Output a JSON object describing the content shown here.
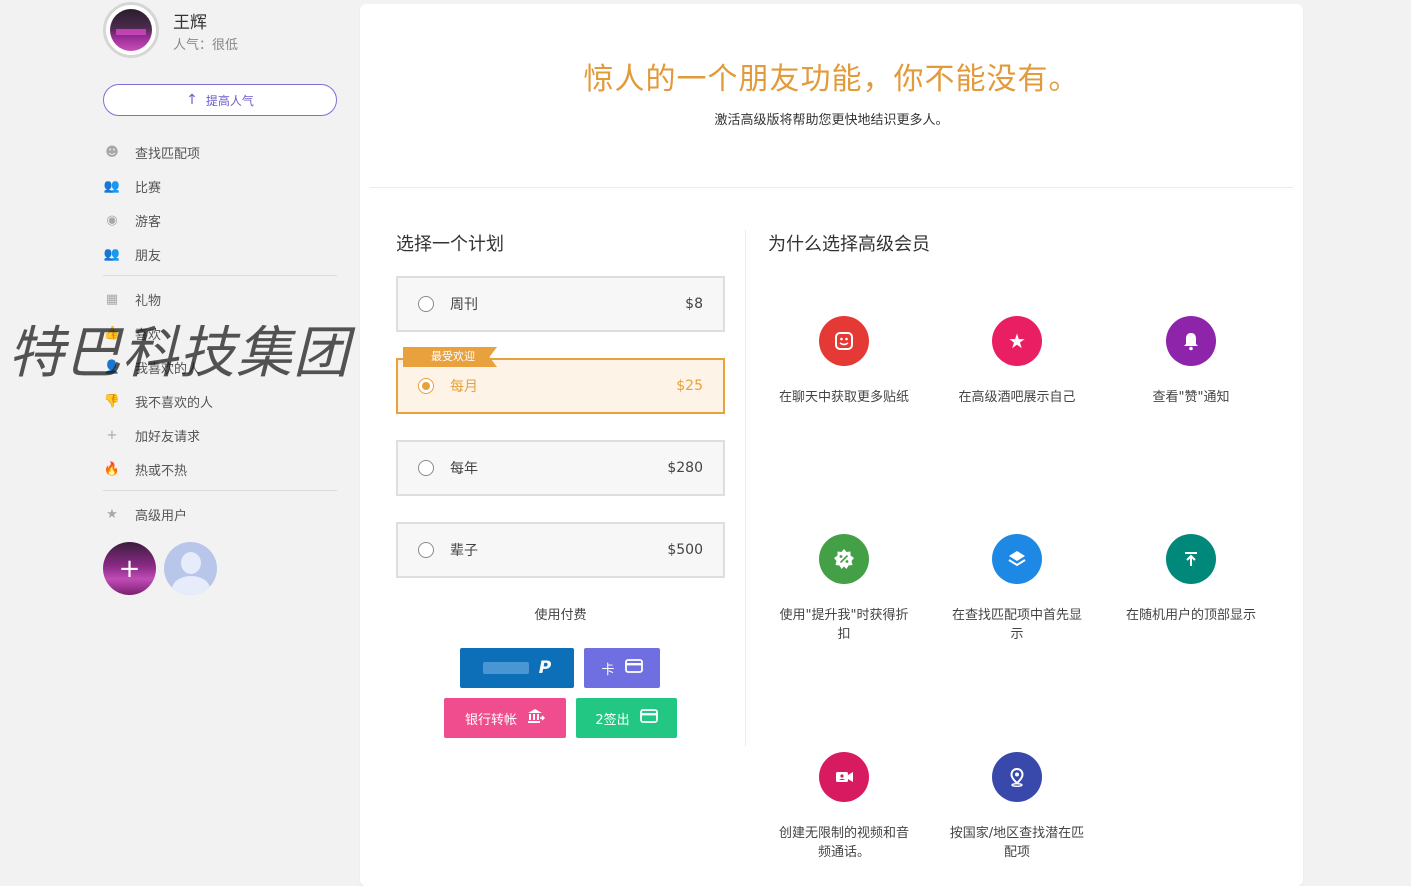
{
  "sidebar": {
    "username": "王辉",
    "popularity": "人气：很低",
    "boost_label": "提高人气",
    "menu_group1": [
      {
        "label": "查找匹配项",
        "icon": "smiley-icon"
      },
      {
        "label": "比赛",
        "icon": "people-check-icon"
      },
      {
        "label": "游客",
        "icon": "eye-icon"
      },
      {
        "label": "朋友",
        "icon": "friends-icon"
      }
    ],
    "menu_group2": [
      {
        "label": "礼物",
        "icon": "gift-icon"
      },
      {
        "label": "喜欢",
        "icon": "thumbs-up-icon"
      },
      {
        "label": "我喜欢的人",
        "icon": "person-heart-icon"
      },
      {
        "label": "我不喜欢的人",
        "icon": "thumbs-down-icon"
      },
      {
        "label": "加好友请求",
        "icon": "add-friend-icon"
      },
      {
        "label": "热或不热",
        "icon": "flame-icon"
      }
    ],
    "menu_group3": [
      {
        "label": "高级用户",
        "icon": "star-icon"
      }
    ],
    "add_icon": "+"
  },
  "watermark": "特巴科技集团",
  "main": {
    "headline": "惊人的一个朋友功能，你不能没有。",
    "subline": "激活高级版将帮助您更快地结识更多人。",
    "plans_title": "选择一个计划",
    "why_title": "为什么选择高级会员",
    "popular_badge": "最受欢迎",
    "plans": [
      {
        "name": "周刊",
        "price": "$8"
      },
      {
        "name": "每月",
        "price": "$25"
      },
      {
        "name": "每年",
        "price": "$280"
      },
      {
        "name": "辈子",
        "price": "$500"
      }
    ],
    "selected_plan": "每月",
    "pay_label": "使用付费",
    "pay_buttons": {
      "card": "卡",
      "bank": "银行转帐",
      "checkout": "2签出"
    },
    "features": [
      {
        "text": "在聊天中获取更多贴纸",
        "icon": "sticker-icon",
        "color": "#e53935"
      },
      {
        "text": "在高级酒吧展示自己",
        "icon": "star-icon",
        "color": "#e91e63"
      },
      {
        "text": "查看\"赞\"通知",
        "icon": "bell-icon",
        "color": "#8e24aa"
      },
      {
        "text": "使用\"提升我\"时获得折扣",
        "icon": "discount-icon",
        "color": "#43a047"
      },
      {
        "text": "在查找匹配项中首先显示",
        "icon": "layers-icon",
        "color": "#1e88e5"
      },
      {
        "text": "在随机用户的顶部显示",
        "icon": "upload-icon",
        "color": "#00897b"
      },
      {
        "text": "创建无限制的视频和音频通话。",
        "icon": "video-call-icon",
        "color": "#d81b60"
      },
      {
        "text": "按国家/地区查找潜在匹配项",
        "icon": "location-pin-icon",
        "color": "#3949ab"
      }
    ]
  }
}
